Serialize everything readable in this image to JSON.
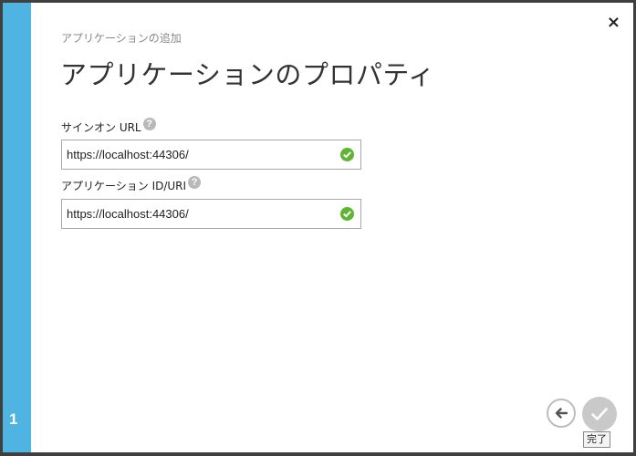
{
  "step": {
    "number": "1"
  },
  "header": {
    "subtitle": "アプリケーションの追加",
    "title": "アプリケーションのプロパティ",
    "close_glyph": "×"
  },
  "form": {
    "signon_url": {
      "label": "サインオン URL",
      "value": "https://localhost:44306/",
      "help": "?",
      "valid_icon": "check-circle-icon"
    },
    "app_id_uri": {
      "label": "アプリケーション ID/URI",
      "value": "https://localhost:44306/",
      "help": "?",
      "valid_icon": "check-circle-icon"
    }
  },
  "footer": {
    "back_icon": "arrow-left-icon",
    "done_icon": "checkmark-icon",
    "done_tooltip": "完了"
  },
  "colors": {
    "step_bar": "#4fb4e1",
    "valid_check": "#5db531",
    "border": "#a8a8a8"
  }
}
